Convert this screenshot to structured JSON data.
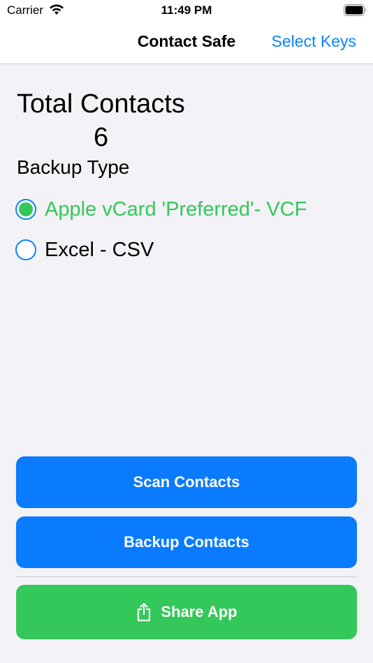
{
  "status_bar": {
    "carrier": "Carrier",
    "time": "11:49 PM",
    "wifi_icon": "wifi-icon",
    "battery_icon": "battery-icon"
  },
  "nav": {
    "title": "Contact Safe",
    "right_button": "Select Keys"
  },
  "summary": {
    "total_label": "Total Contacts",
    "total_count": "6"
  },
  "backup_type": {
    "label": "Backup Type",
    "options": [
      {
        "label": "Apple vCard 'Preferred'- VCF",
        "selected": true
      },
      {
        "label": "Excel - CSV",
        "selected": false
      }
    ]
  },
  "actions": {
    "scan_label": "Scan Contacts",
    "backup_label": "Backup Contacts",
    "share_label": "Share App",
    "share_icon": "share-icon"
  },
  "colors": {
    "accent_blue": "#0a84ff",
    "button_blue": "#0a7bff",
    "green": "#34c759",
    "background": "#f2f2f7"
  }
}
